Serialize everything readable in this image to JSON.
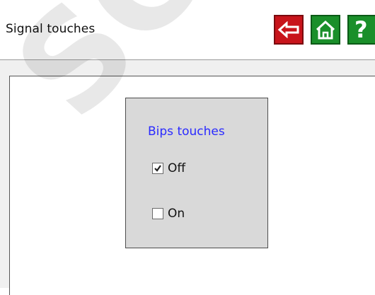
{
  "header": {
    "title": "Signal touches",
    "help_label": "?"
  },
  "panel": {
    "group_title": "Bips touches",
    "options": [
      {
        "label": "Off",
        "checked": true
      },
      {
        "label": "On",
        "checked": false
      }
    ]
  },
  "watermark": {
    "text": "SCH"
  },
  "icons": {
    "back": "arrow-left-icon",
    "home": "home-icon"
  },
  "colors": {
    "back_button": "#c8141b",
    "home_button": "#1a8f2a",
    "help_button": "#1a8f2a",
    "group_title": "#2a2aff",
    "group_background": "#d9d9d9"
  }
}
